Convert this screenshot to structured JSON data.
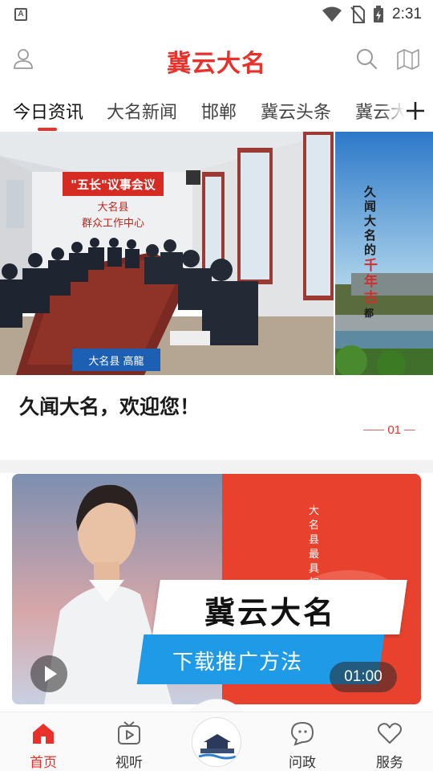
{
  "status_bar": {
    "time": "2:31",
    "notification_icon": "a-letter-icon",
    "icons": [
      "wifi-icon",
      "no-sim-icon",
      "battery-charging-icon"
    ]
  },
  "header": {
    "title": "冀云大名",
    "left_icon": "user-icon",
    "right_icons": [
      "search-icon",
      "map-icon"
    ]
  },
  "tabs": {
    "items": [
      "今日资讯",
      "大名新闻",
      "邯郸",
      "冀云头条",
      "冀云大"
    ],
    "active_index": 0,
    "add_icon": "plus-icon"
  },
  "banner": {
    "main_image": {
      "sign_main": "\"五长\"议事会议",
      "sign_sub1": "大名县",
      "sign_sub2": "群众工作中心",
      "nameplate": "大名县 高龍"
    },
    "next_image": {
      "vertical_text": "久闻大名的千年古都"
    },
    "caption": "久闻大名，欢迎您！",
    "indicator": "01"
  },
  "video_card": {
    "title": "冀云大名",
    "subtitle": "下载推广方法",
    "vertical_text": "大名县最具权",
    "duration": "01:00",
    "play_icon": "play-icon"
  },
  "bottom_nav": {
    "items": [
      {
        "label": "首页",
        "icon": "home-icon"
      },
      {
        "label": "视听",
        "icon": "tv-icon"
      },
      {
        "label": "",
        "icon": "city-logo-icon"
      },
      {
        "label": "问政",
        "icon": "chat-bubble-icon"
      },
      {
        "label": "服务",
        "icon": "heart-icon"
      }
    ],
    "active_index": 0
  },
  "colors": {
    "brand_red": "#e8312b",
    "video_blue": "#1e9ae6"
  }
}
